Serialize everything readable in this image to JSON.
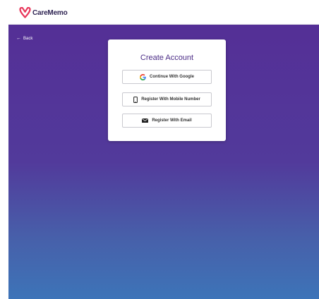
{
  "brand": {
    "name": "CareMemo",
    "accent": "#e8365a",
    "text_color": "#2f2453"
  },
  "nav": {
    "back_label": "Back",
    "back_icon": "arrow-left-icon"
  },
  "background": {
    "gradient": [
      "#542f96",
      "#523a9b",
      "#4760aa",
      "#3d74b8"
    ]
  },
  "card": {
    "title": "Create Account",
    "buttons": [
      {
        "label": "Continue With Google",
        "icon": "google-icon"
      },
      {
        "label": "Register With Mobile Number",
        "icon": "mobile-phone-icon"
      },
      {
        "label": "Register With Email",
        "icon": "envelope-icon"
      }
    ]
  }
}
